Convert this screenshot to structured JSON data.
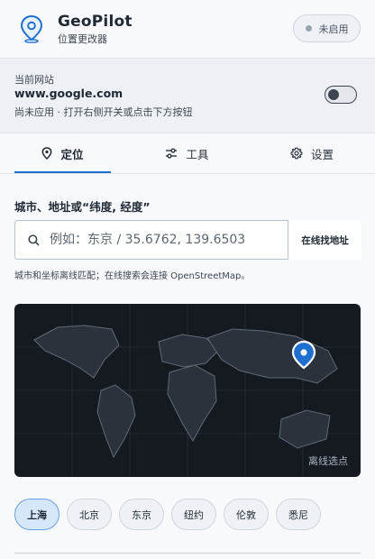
{
  "app": {
    "name": "GeoPilot",
    "subtitle": "位置更改器",
    "status_label": "未启用",
    "logo_icon": "location-pin-icon",
    "accent_color": "#1f6fd1"
  },
  "site": {
    "caption": "当前网站",
    "domain": "www.google.com",
    "hint": "尚未应用 · 打开右侧开关或点击下方按钮",
    "toggle_on": false
  },
  "tabs": [
    {
      "label": "定位",
      "icon": "location-icon",
      "active": true
    },
    {
      "label": "工具",
      "icon": "sliders-icon",
      "active": false
    },
    {
      "label": "设置",
      "icon": "gear-icon",
      "active": false
    }
  ],
  "search": {
    "label": "城市、地址或“纬度, 经度”",
    "placeholder": "例如：东京 / 35.6762, 139.6503",
    "value": "",
    "button_label": "在线找地址",
    "help": "城市和坐标离线匹配；在线搜索会连接 OpenStreetMap。"
  },
  "map": {
    "caption": "离线选点",
    "marker_icon": "map-pin-icon"
  },
  "cities": [
    {
      "label": "上海",
      "active": true
    },
    {
      "label": "北京",
      "active": false
    },
    {
      "label": "东京",
      "active": false
    },
    {
      "label": "纽约",
      "active": false
    },
    {
      "label": "伦敦",
      "active": false
    },
    {
      "label": "悉尼",
      "active": false
    }
  ]
}
